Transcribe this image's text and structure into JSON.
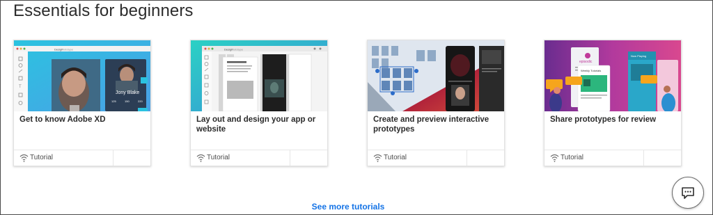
{
  "section": {
    "title": "Essentials for beginners"
  },
  "cards": [
    {
      "title": "Get to know Adobe XD",
      "tag": "Tutorial",
      "thumb_text": {
        "name": "Jony Blake",
        "stats": [
          "125",
          "150",
          "220"
        ],
        "app_tab": "Design",
        "app_tab2": "Prototype"
      }
    },
    {
      "title": "Lay out and design your app or website",
      "tag": "Tutorial",
      "thumb_text": {
        "app_tab": "Design",
        "app_tab2": "Prototype"
      }
    },
    {
      "title": "Create and preview interactive prototypes",
      "tag": "Tutorial",
      "thumb_text": {}
    },
    {
      "title": "Share prototypes for review",
      "tag": "Tutorial",
      "thumb_text": {
        "brand": "episodic",
        "panel_title": "Weekly Tutorials",
        "panel2_title": "Now Playing"
      }
    }
  ],
  "see_more": {
    "label": "See more tutorials"
  },
  "icons": {
    "tag_icon": "tutorial-signal-icon",
    "chat": "chat-bubble-icon"
  },
  "colors": {
    "link": "#1473e6",
    "card_border": "#e1e1e1",
    "text": "#2c2c2c"
  }
}
